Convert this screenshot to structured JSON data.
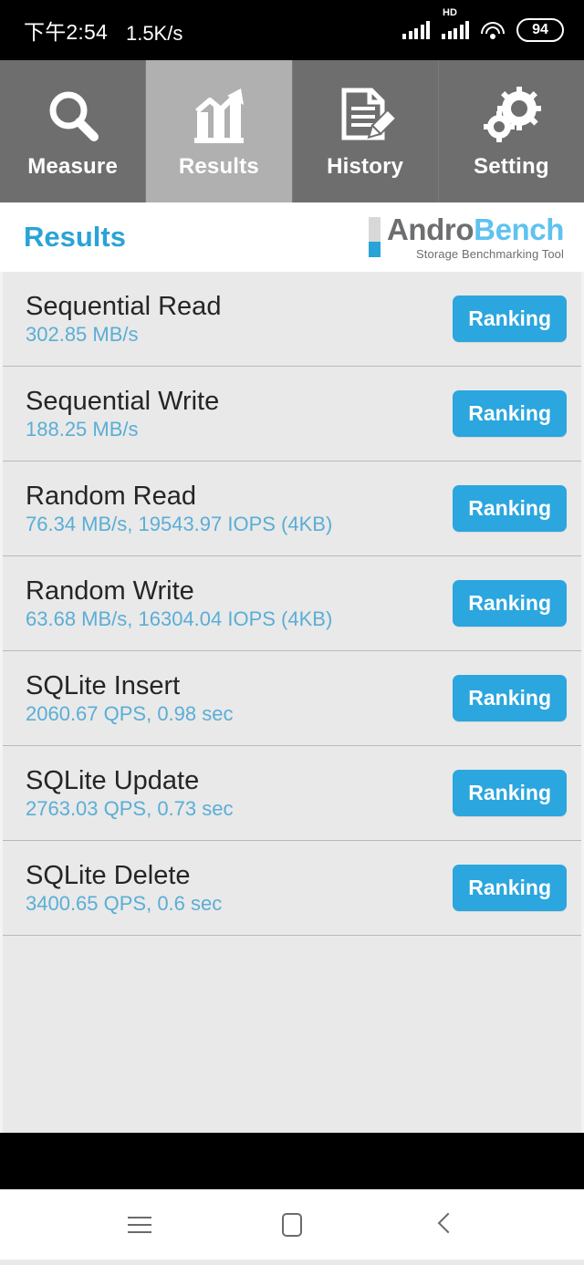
{
  "statusbar": {
    "time": "下午2:54",
    "network_speed": "1.5K/s",
    "hd_label": "HD",
    "battery_level": "94",
    "icons": {
      "signal": "signal-bars-icon",
      "signal_hd": "signal-bars-hd-icon",
      "wifi": "wifi-icon",
      "battery": "battery-icon"
    }
  },
  "tabs": [
    {
      "label": "Measure",
      "icon": "magnifier-icon",
      "active": false
    },
    {
      "label": "Results",
      "icon": "bar-chart-trend-icon",
      "active": true
    },
    {
      "label": "History",
      "icon": "document-pencil-icon",
      "active": false
    },
    {
      "label": "Setting",
      "icon": "gears-icon",
      "active": false
    }
  ],
  "header": {
    "page_title": "Results",
    "logo": {
      "name_part1": "Andro",
      "name_part2": "Bench",
      "tagline": "Storage Benchmarking Tool"
    }
  },
  "results": {
    "ranking_label": "Ranking",
    "rows": [
      {
        "title": "Sequential Read",
        "value": "302.85 MB/s"
      },
      {
        "title": "Sequential Write",
        "value": "188.25 MB/s"
      },
      {
        "title": "Random Read",
        "value": "76.34 MB/s, 19543.97 IOPS (4KB)"
      },
      {
        "title": "Random Write",
        "value": "63.68 MB/s, 16304.04 IOPS (4KB)"
      },
      {
        "title": "SQLite Insert",
        "value": "2060.67 QPS, 0.98 sec"
      },
      {
        "title": "SQLite Update",
        "value": "2763.03 QPS, 0.73 sec"
      },
      {
        "title": "SQLite Delete",
        "value": "3400.65 QPS, 0.6 sec"
      }
    ]
  },
  "navbar": {
    "recents": "recents-menu-icon",
    "home": "home-icon",
    "back": "back-icon"
  },
  "colors": {
    "accent_blue": "#2ba6de",
    "value_blue": "#5aaed6",
    "logo_blue": "#5fc2ef",
    "tab_inactive": "#6e6e6e",
    "tab_active": "#b0b0b0",
    "list_bg": "#e9e9e9"
  }
}
